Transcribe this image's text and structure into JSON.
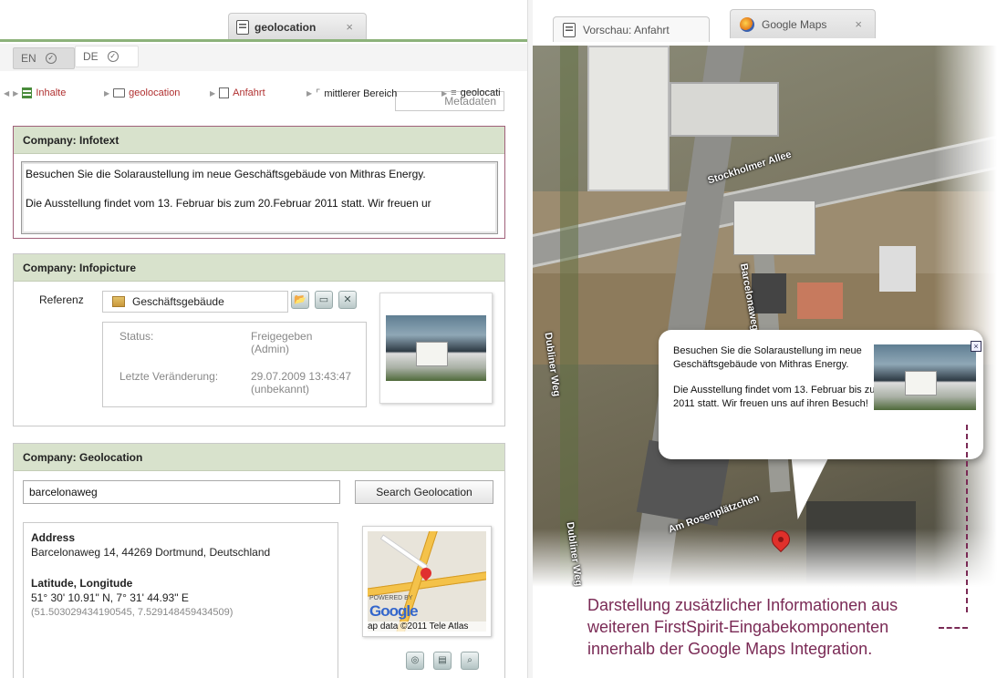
{
  "left_tab": {
    "title": "geolocation",
    "close": "×"
  },
  "languages": [
    {
      "code": "EN",
      "selected": true
    },
    {
      "code": "DE",
      "selected": false
    }
  ],
  "metadata_label": "Metadaten",
  "breadcrumb": [
    {
      "label": "Inhalte",
      "color": "red"
    },
    {
      "label": "geolocation",
      "color": "red"
    },
    {
      "label": "Anfahrt",
      "color": "red"
    },
    {
      "label": "mittlerer Bereich",
      "color": "dark"
    },
    {
      "label": "geolocati",
      "color": "dark"
    }
  ],
  "infotext": {
    "header": "Company: Infotext",
    "line1": "Besuchen Sie die Solaraustellung im neue Geschäftsgebäude von Mithras Energy.",
    "line2": "Die Ausstellung findet vom 13. Februar bis zum 20.Februar 2011 statt. Wir freuen ur"
  },
  "infopicture": {
    "header": "Company: Infopicture",
    "ref_label": "Referenz",
    "ref_value": "Geschäftsgebäude",
    "status_key": "Status:",
    "status_val1": "Freigegeben",
    "status_val2": "(Admin)",
    "changed_key": "Letzte Veränderung:",
    "changed_val1": "29.07.2009 13:43:47",
    "changed_val2": "(unbekannt)"
  },
  "geolocation": {
    "header": "Company: Geolocation",
    "input_value": "barcelonaweg",
    "search_label": "Search Geolocation",
    "address_title": "Address",
    "address": "Barcelonaweg 14, 44269 Dortmund, Deutschland",
    "latlng_title": "Latitude, Longitude",
    "latlng_dms": "51° 30' 10.91\" N, 7° 31' 44.93\" E",
    "latlng_dec": "(51.503029434190545, 7.529148459434509)",
    "powered_by": "POWERED BY",
    "google": "Google",
    "map_data": "ap data ©2011 Tele Atlas"
  },
  "right_tabs": [
    {
      "title": "Vorschau: Anfahrt"
    },
    {
      "title": "Google Maps",
      "close": "×"
    }
  ],
  "map": {
    "streets": [
      "Stockholmer Allee",
      "Barcelonaweg",
      "Dubliner Weg",
      "Am Rosenplätzchen",
      "Dubliner Weg"
    ],
    "bubble": {
      "text1": "Besuchen Sie die Solaraustellung im neue Geschäftsgebäude von Mithras Energy.",
      "text2": "Die Ausstellung findet vom 13. Februar bis zum 20.Februar 2011 statt. Wir freuen uns auf ihren Besuch!",
      "close": "×"
    }
  },
  "caption": {
    "line1": "Darstellung zusätzlicher Informationen aus",
    "line2": "weiteren FirstSpirit-Eingabekomponenten",
    "line3": "innerhalb der Google Maps Integration."
  },
  "colors": {
    "panel_header": "#d8e2cc",
    "accent_green": "#8cb27a",
    "caption": "#7a2a55",
    "link_red": "#b03030"
  }
}
